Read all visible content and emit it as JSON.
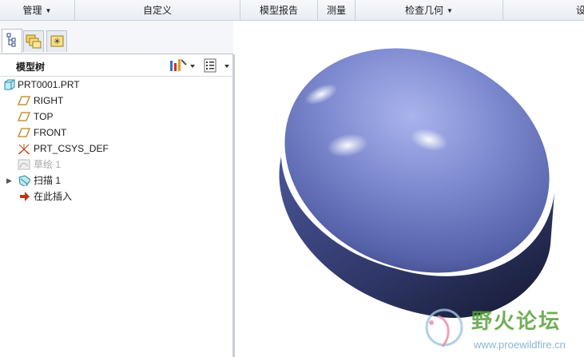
{
  "ribbon": {
    "groups": [
      {
        "label": "管理",
        "has_dropdown": true
      },
      {
        "label": "自定义",
        "has_dropdown": false
      },
      {
        "label": "模型报告",
        "has_dropdown": false
      },
      {
        "label": "测量",
        "has_dropdown": false
      },
      {
        "label": "检查几何",
        "has_dropdown": true
      },
      {
        "label": "设",
        "has_dropdown": false
      }
    ]
  },
  "navigator": {
    "tabs": [
      {
        "name": "model-tree-tab",
        "icon": "tree-icon",
        "active": true
      },
      {
        "name": "folder-browser-tab",
        "icon": "folders-icon",
        "active": false
      },
      {
        "name": "favorites-tab",
        "icon": "star-folder-icon",
        "active": false
      }
    ],
    "tree_title": "模型树",
    "header_buttons": [
      "settings-tools-icon",
      "show-list-icon"
    ]
  },
  "tree": {
    "items": [
      {
        "label": "PRT0001.PRT",
        "icon": "part-icon",
        "level": 0,
        "dimmed": false
      },
      {
        "label": "RIGHT",
        "icon": "datum-plane-icon",
        "level": 1,
        "dimmed": false
      },
      {
        "label": "TOP",
        "icon": "datum-plane-icon",
        "level": 1,
        "dimmed": false
      },
      {
        "label": "FRONT",
        "icon": "datum-plane-icon",
        "level": 1,
        "dimmed": false
      },
      {
        "label": "PRT_CSYS_DEF",
        "icon": "csys-icon",
        "level": 1,
        "dimmed": false
      },
      {
        "label": "草绘 1",
        "icon": "sketch-icon",
        "level": 1,
        "dimmed": true
      },
      {
        "label": "扫描 1",
        "icon": "sweep-icon",
        "level": 1,
        "dimmed": false,
        "expandable": true
      },
      {
        "label": "在此插入",
        "icon": "insert-here-arrow-icon",
        "level": 1,
        "dimmed": false
      }
    ]
  },
  "colors": {
    "model_light": "#a9b4ec",
    "model_mid": "#6f7cc4",
    "model_dark": "#232a4e",
    "insert_arrow": "#d42a1a",
    "watermark_green": "#58a23a"
  },
  "watermark": {
    "title": "野火论坛",
    "url": "www.proewildfire.cn"
  }
}
